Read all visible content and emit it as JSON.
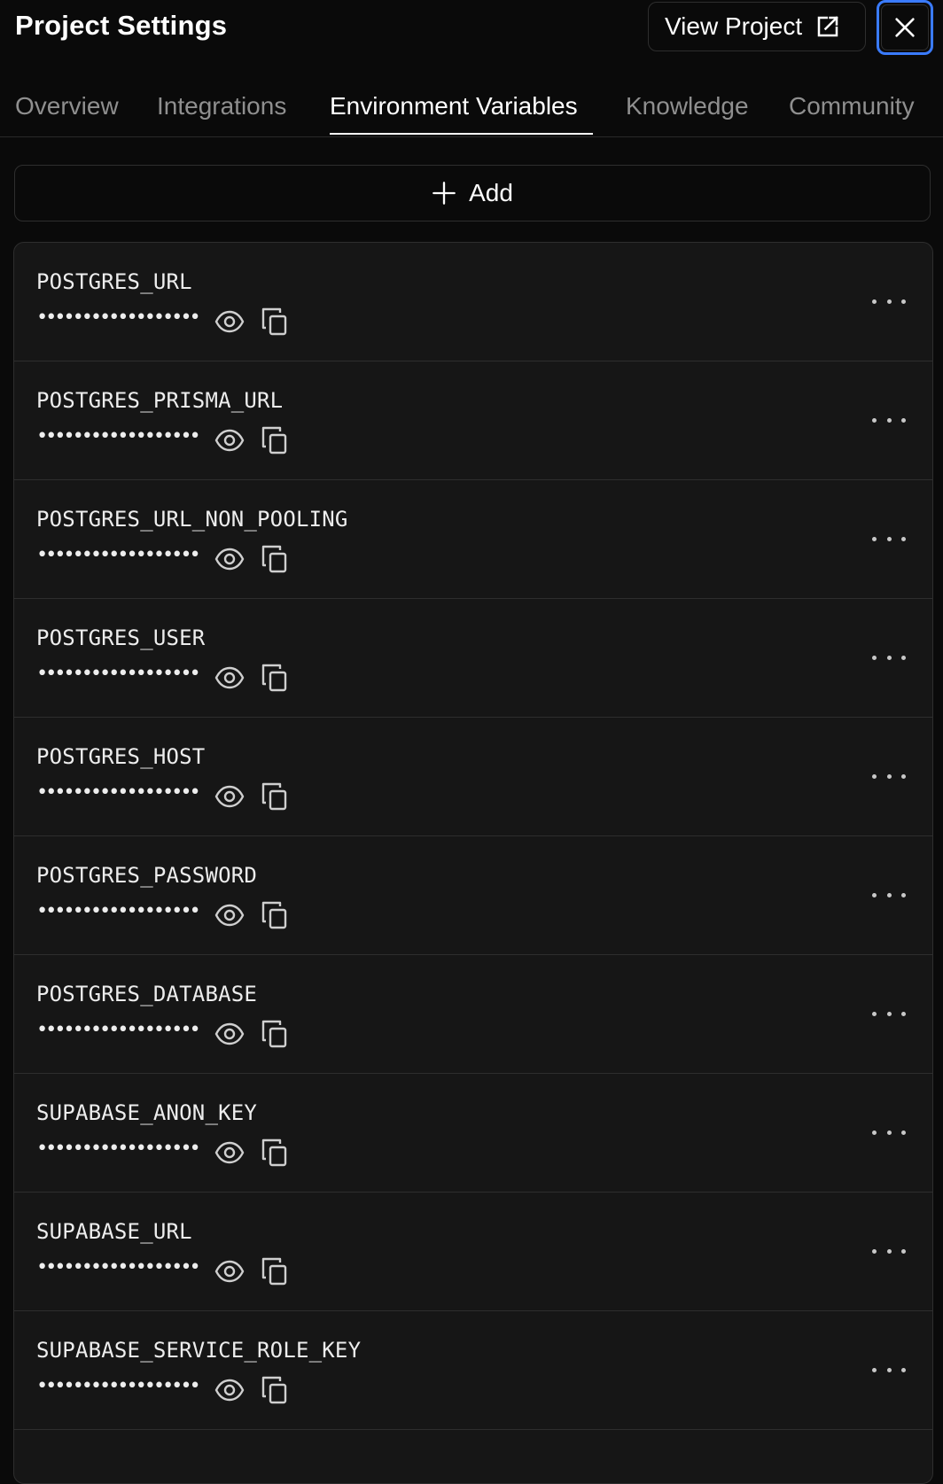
{
  "header": {
    "title": "Project Settings",
    "view_project_label": "View Project",
    "view_project_icon": "external-link-icon",
    "close_icon": "close-icon"
  },
  "tabs": [
    {
      "label": "Overview",
      "active": false
    },
    {
      "label": "Integrations",
      "active": false
    },
    {
      "label": "Environment Variables",
      "active": true
    },
    {
      "label": "Knowledge",
      "active": false
    },
    {
      "label": "Community",
      "active": false
    }
  ],
  "add_button": {
    "label": "Add",
    "icon": "plus-icon"
  },
  "variables": [
    {
      "name": "POSTGRES_URL",
      "masked_value": "••••••••••••••••••"
    },
    {
      "name": "POSTGRES_PRISMA_URL",
      "masked_value": "••••••••••••••••••"
    },
    {
      "name": "POSTGRES_URL_NON_POOLING",
      "masked_value": "••••••••••••••••••"
    },
    {
      "name": "POSTGRES_USER",
      "masked_value": "••••••••••••••••••"
    },
    {
      "name": "POSTGRES_HOST",
      "masked_value": "••••••••••••••••••"
    },
    {
      "name": "POSTGRES_PASSWORD",
      "masked_value": "••••••••••••••••••"
    },
    {
      "name": "POSTGRES_DATABASE",
      "masked_value": "••••••••••••••••••"
    },
    {
      "name": "SUPABASE_ANON_KEY",
      "masked_value": "••••••••••••••••••"
    },
    {
      "name": "SUPABASE_URL",
      "masked_value": "••••••••••••••••••"
    },
    {
      "name": "SUPABASE_SERVICE_ROLE_KEY",
      "masked_value": "••••••••••••••••••"
    }
  ],
  "row_icons": {
    "reveal": "eye-icon",
    "copy": "copy-icon",
    "menu": "more-horizontal-icon"
  },
  "colors": {
    "background": "#0a0a0a",
    "panel": "#161616",
    "border": "#2e2e2e",
    "focus_ring": "#3a7bff",
    "muted_text": "#8f8f8f"
  }
}
